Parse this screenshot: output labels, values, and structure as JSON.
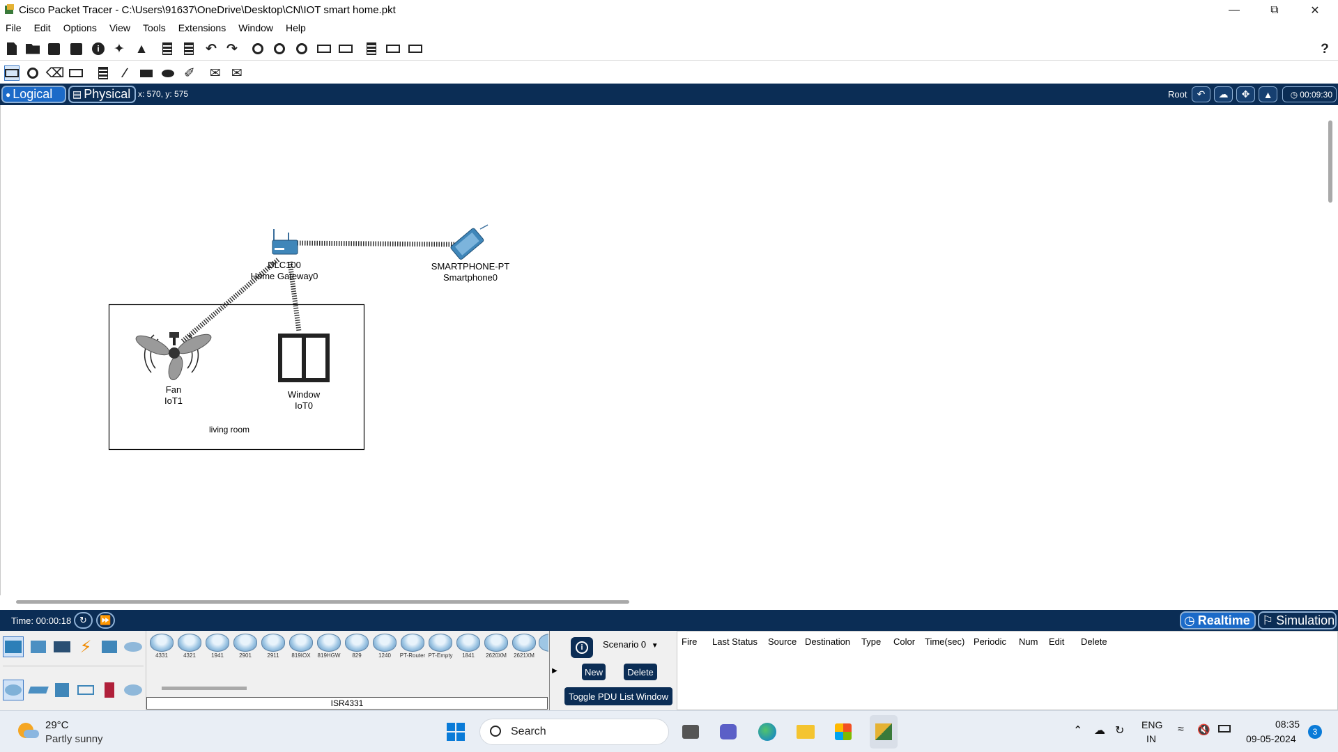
{
  "window": {
    "title": "Cisco Packet Tracer - C:\\Users\\91637\\OneDrive\\Desktop\\CN\\IOT smart home.pkt"
  },
  "menu": [
    "File",
    "Edit",
    "Options",
    "View",
    "Tools",
    "Extensions",
    "Window",
    "Help"
  ],
  "toolbar": {
    "help_glyph": "?"
  },
  "workspace_bar": {
    "logical_label": "Logical",
    "physical_label": "Physical",
    "coords": "x: 570, y: 575",
    "root_label": "Root",
    "clock": "00:09:30"
  },
  "canvas": {
    "gateway": {
      "model": "DLC100",
      "name": "Home Gateway0"
    },
    "smartphone": {
      "model": "SMARTPHONE-PT",
      "name": "Smartphone0"
    },
    "fan": {
      "model": "Fan",
      "name": "IoT1"
    },
    "window_device": {
      "model": "Window",
      "name": "IoT0"
    },
    "cluster_label": "living room"
  },
  "status": {
    "time": "Time: 00:00:18",
    "realtime_label": "Realtime",
    "simulation_label": "Simulation"
  },
  "device_strip": {
    "routers": [
      "4331",
      "4321",
      "1941",
      "2901",
      "2911",
      "819IOX",
      "819HGW",
      "829",
      "1240",
      "PT-Router",
      "PT-Empty",
      "1841",
      "2620XM",
      "2621XM"
    ],
    "selected": "ISR4331"
  },
  "scenario": {
    "value": "Scenario 0",
    "new_label": "New",
    "delete_label": "Delete",
    "toggle_label": "Toggle PDU List Window"
  },
  "pdu_columns": [
    "Fire",
    "Last Status",
    "Source",
    "Destination",
    "Type",
    "Color",
    "Time(sec)",
    "Periodic",
    "Num",
    "Edit",
    "Delete"
  ],
  "taskbar": {
    "weather_temp": "29°C",
    "weather_desc": "Partly sunny",
    "search_label": "Search",
    "lang_line1": "ENG",
    "lang_line2": "IN",
    "time": "08:35",
    "date": "09-05-2024",
    "notification_count": "3"
  },
  "colors": {
    "bar_navy": "#0b2d55",
    "active_tab": "#1b6ac8"
  }
}
